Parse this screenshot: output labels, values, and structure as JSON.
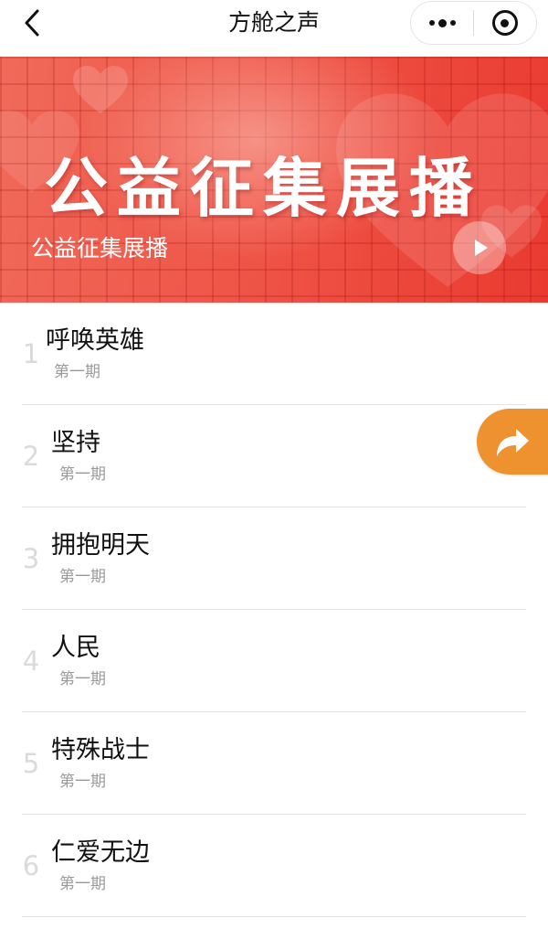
{
  "navbar": {
    "title": "方舱之声",
    "back_icon": "chevron-left-icon",
    "more_icon": "more-dots-icon",
    "close_icon": "target-circle-icon"
  },
  "banner": {
    "title": "公益征集展播",
    "subtitle": "公益征集展播",
    "play_icon": "play-icon",
    "colors": {
      "start": "#f06a5a",
      "end": "#ea3a30"
    }
  },
  "list": {
    "items": [
      {
        "index": "1",
        "title": "呼唤英雄",
        "subtitle": "第一期"
      },
      {
        "index": "2",
        "title": "坚持",
        "subtitle": "第一期"
      },
      {
        "index": "3",
        "title": "拥抱明天",
        "subtitle": "第一期"
      },
      {
        "index": "4",
        "title": "人民",
        "subtitle": "第一期"
      },
      {
        "index": "5",
        "title": "特殊战士",
        "subtitle": "第一期"
      },
      {
        "index": "6",
        "title": "仁爱无边",
        "subtitle": "第一期"
      }
    ]
  },
  "share_button": {
    "icon": "share-arrow-icon",
    "color": "#ee922f"
  }
}
